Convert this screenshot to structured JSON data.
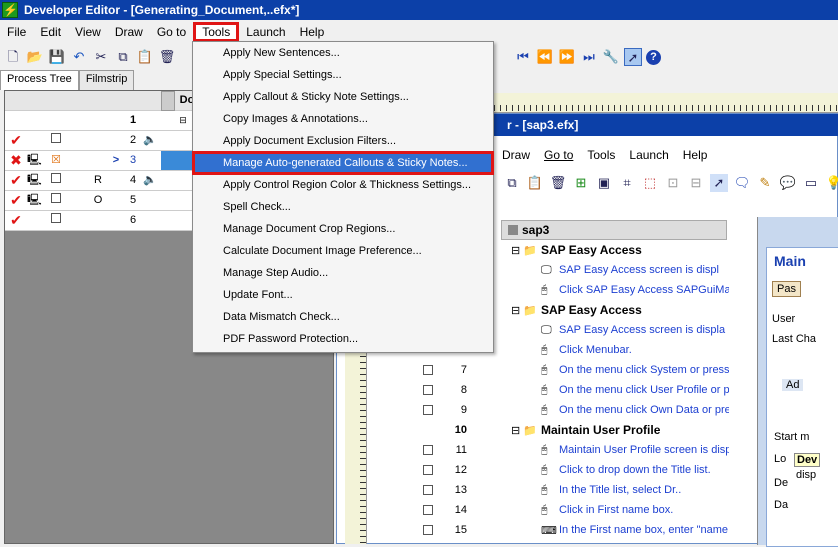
{
  "window": {
    "title": "Developer Editor - [Generating_Document,..efx*]"
  },
  "menubar": [
    "File",
    "Edit",
    "View",
    "Draw",
    "Go to",
    "Tools",
    "Launch",
    "Help"
  ],
  "tabs": {
    "process_tree": "Process Tree",
    "filmstrip": "Filmstrip"
  },
  "grid": {
    "header_col": "Do",
    "rows": [
      {
        "num": "1",
        "letter": ""
      },
      {
        "num": "2",
        "letter": ""
      },
      {
        "num": "3",
        "letter": ""
      },
      {
        "num": "4",
        "letter": "R"
      },
      {
        "num": "5",
        "letter": "O"
      },
      {
        "num": "6",
        "letter": ""
      }
    ]
  },
  "tools_menu": {
    "items": [
      "Apply New Sentences...",
      "Apply Special Settings...",
      "Apply Callout & Sticky Note Settings...",
      "Copy Images & Annotations...",
      "Apply Document Exclusion Filters...",
      "Manage Auto-generated Callouts & Sticky Notes...",
      "Apply Control Region Color & Thickness Settings...",
      "Spell Check...",
      "Manage Document Crop Regions...",
      "Calculate Document Image Preference...",
      "Manage Step Audio...",
      "Update Font...",
      "Data Mismatch Check...",
      "PDF Password Protection..."
    ],
    "selected_index": 5
  },
  "inner_window": {
    "title": "r - [sap3.efx]",
    "menu": [
      "Draw",
      "Go to",
      "Tools",
      "Launch",
      "Help"
    ],
    "root": "sap3",
    "rows": [
      {
        "num": "",
        "folder": "SAP Easy Access",
        "text": ""
      },
      {
        "num": "",
        "folder": "",
        "text": "SAP Easy Access screen is displ"
      },
      {
        "num": "",
        "folder": "",
        "text": "Click SAP Easy Access SAPGuiMa"
      },
      {
        "num": "",
        "folder": "SAP Easy Access",
        "text": ""
      },
      {
        "num": "",
        "folder": "",
        "text": "SAP Easy Access screen is displa"
      },
      {
        "num": "",
        "folder": "",
        "text": "Click Menubar."
      },
      {
        "num": "7",
        "folder": "",
        "text": "On the menu click System or press"
      },
      {
        "num": "8",
        "folder": "",
        "text": "On the menu click User Profile or p"
      },
      {
        "num": "9",
        "folder": "",
        "text": "On the menu click Own Data or pre"
      },
      {
        "num": "10",
        "folder": "Maintain User Profile",
        "text": ""
      },
      {
        "num": "11",
        "folder": "",
        "text": "Maintain User Profile screen is disp"
      },
      {
        "num": "12",
        "folder": "",
        "text": "Click to drop down the Title list."
      },
      {
        "num": "13",
        "folder": "",
        "text": "In the Title list, select Dr.."
      },
      {
        "num": "14",
        "folder": "",
        "text": "Click in First name box."
      },
      {
        "num": "15",
        "folder": "",
        "text": "In the First name box, enter \"name"
      }
    ],
    "right_labels": [
      "Main",
      "Pas",
      "User",
      "Last Cha",
      "Ad",
      "Start m",
      "Lo",
      "Dev",
      "disp",
      "De",
      "Da"
    ]
  }
}
